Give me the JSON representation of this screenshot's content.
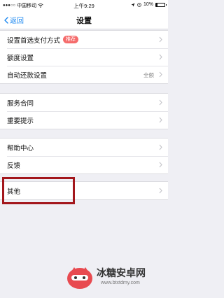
{
  "status_bar": {
    "carrier": "中国移动",
    "time": "上午9:29",
    "battery": "10%"
  },
  "nav": {
    "back_label": "返回",
    "title": "设置"
  },
  "groups": [
    {
      "items": [
        {
          "label": "设置首选支付方式",
          "badge": "推荐"
        },
        {
          "label": "额度设置"
        },
        {
          "label": "自动还款设置",
          "value": "全额"
        }
      ]
    },
    {
      "items": [
        {
          "label": "服务合同"
        },
        {
          "label": "重要提示"
        }
      ]
    },
    {
      "items": [
        {
          "label": "帮助中心"
        },
        {
          "label": "反馈"
        }
      ]
    },
    {
      "items": [
        {
          "label": "其他"
        }
      ]
    }
  ],
  "watermark": {
    "name": "冰糖安卓网",
    "url": "www.btxtdmy.com"
  },
  "colors": {
    "accent": "#1a87f0",
    "badge": "#f56b6b",
    "highlight": "#a3171c"
  }
}
